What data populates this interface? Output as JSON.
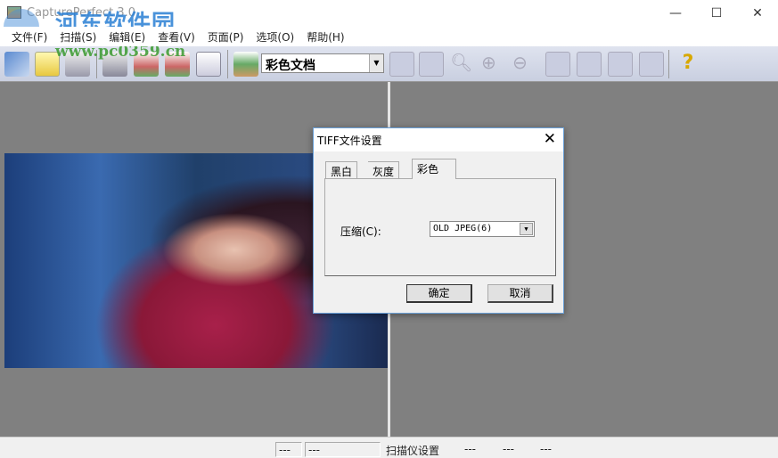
{
  "window": {
    "title": "CapturePerfect 3.0",
    "minimize": "—",
    "maximize": "☐",
    "close": "✕"
  },
  "watermark": {
    "name": "河东软件园",
    "url": "www.pc0359.cn"
  },
  "menu": [
    "文件(F)",
    "扫描(S)",
    "编辑(E)",
    "查看(V)",
    "页面(P)",
    "选项(O)",
    "帮助(H)"
  ],
  "toolbar": {
    "profile_value": "彩色文档",
    "icons": [
      "open-icon",
      "save-icon",
      "print-icon",
      "scan-icon",
      "scan-batch-icon",
      "scan-page-icon",
      "email-icon",
      "scan-settings-icon",
      "fit-width-icon",
      "fit-page-icon",
      "zoom-icon",
      "zoom-in-icon",
      "zoom-out-icon",
      "page-prev-icon",
      "page-next-icon",
      "page-icon",
      "page-last-icon",
      "help-icon"
    ]
  },
  "status": [
    "---",
    "---",
    "扫描仪设置",
    "---",
    "---",
    "---"
  ],
  "dialog": {
    "title": "TIFF文件设置",
    "tabs": [
      "黑白",
      "灰度",
      "彩色"
    ],
    "active_tab": "彩色",
    "compression_label": "压缩(C):",
    "compression_value": "OLD JPEG(6)",
    "ok": "确定",
    "cancel": "取消"
  }
}
